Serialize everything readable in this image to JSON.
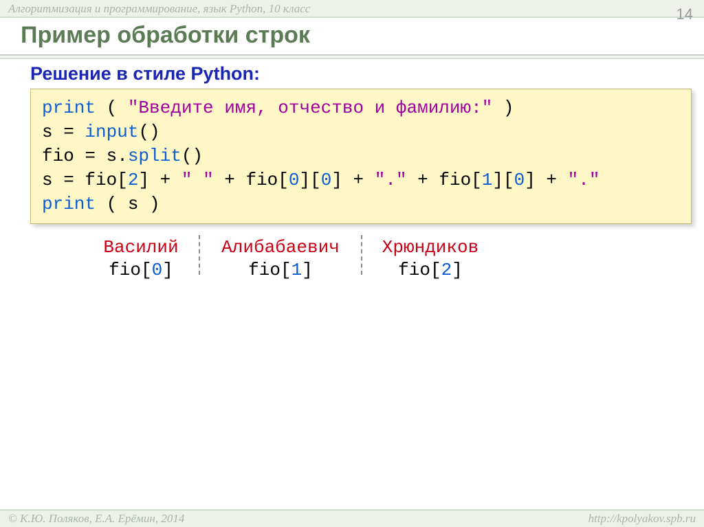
{
  "header": {
    "course_title": "Алгоритмизация и программирование, язык Python, 10 класс",
    "page_number": "14",
    "slide_title": "Пример обработки строк"
  },
  "section": {
    "subhead": "Решение в стиле Python:"
  },
  "code": {
    "kw_print": "print",
    "lparen": " ( ",
    "rparen_close": " )",
    "prompt_str": "\"Введите имя, отчество и фамилию:\"",
    "line2_pre": "s = ",
    "kw_input": "input",
    "line2_post": "()",
    "line3_pre": "fio = s.",
    "kw_split": "split",
    "line3_post": "()",
    "l4_a": "s = fio[",
    "l4_2": "2",
    "l4_b": "] + ",
    "l4_space": "\" \"",
    "l4_c": " + fio[",
    "l4_0a": "0",
    "l4_d": "][",
    "l4_0b": "0",
    "l4_e": "] + ",
    "l4_dot1": "\".\"",
    "l4_f": " + fio[",
    "l4_1": "1",
    "l4_g": "][",
    "l4_0c": "0",
    "l4_h": "] + ",
    "l4_dot2": "\".\"",
    "line5_mid": " ( s )"
  },
  "example": {
    "name1": "Василий",
    "name2": "Алибабаевич",
    "name3": "Хрюндиков",
    "fio0_a": "fio[",
    "fio0_n": "0",
    "fio0_b": "]",
    "fio1_a": "fio[",
    "fio1_n": "1",
    "fio1_b": "]",
    "fio2_a": "fio[",
    "fio2_n": "2",
    "fio2_b": "]"
  },
  "footer": {
    "copyright": "© К.Ю. Поляков, Е.А. Ерёмин, 2014",
    "url": "http://kpolyakov.spb.ru"
  }
}
